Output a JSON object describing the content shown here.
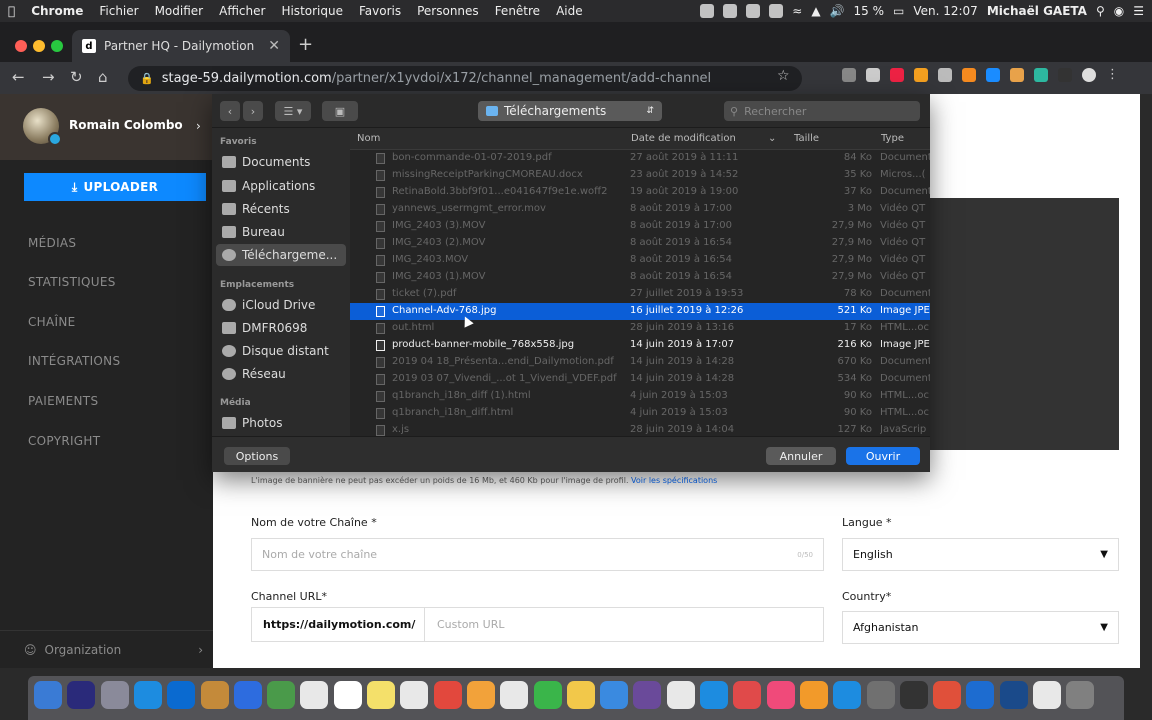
{
  "menubar": {
    "apple": "",
    "app": "Chrome",
    "items": [
      "Fichier",
      "Modifier",
      "Afficher",
      "Historique",
      "Favoris",
      "Personnes",
      "Fenêtre",
      "Aide"
    ],
    "battery": "15 %",
    "datetime": "Ven. 12:07",
    "user": "Michaël GAETA"
  },
  "browser": {
    "tab_title": "Partner HQ - Dailymotion",
    "tab_favicon": "d",
    "url_host": "stage-59.dailymotion.com",
    "url_path": "/partner/x1yvdoi/x172/channel_management/add-channel"
  },
  "sidebar": {
    "user_name": "Romain Colombo",
    "upload_label": "UPLOADER",
    "nav": [
      "MÉDIAS",
      "STATISTIQUES",
      "CHAÎNE",
      "INTÉGRATIONS",
      "PAIEMENTS",
      "COPYRIGHT"
    ],
    "org_label": "Organization"
  },
  "form": {
    "hint_text": "L'image de bannière ne peut pas excéder un poids de 16 Mb, et 460 Kb pour l'image de profil.",
    "hint_link": "Voir les spécifications",
    "name_label": "Nom de votre Chaîne *",
    "name_placeholder": "Nom de votre chaîne",
    "name_counter": "0/50",
    "lang_label": "Langue *",
    "lang_value": "English",
    "url_label": "Channel URL*",
    "url_prefix": "https://dailymotion.com/",
    "url_placeholder": "Custom URL",
    "country_label": "Country*",
    "country_value": "Afghanistan"
  },
  "dialog": {
    "location": "Téléchargements",
    "search_placeholder": "Rechercher",
    "sidebar_favoris_label": "Favoris",
    "favoris": [
      "Documents",
      "Applications",
      "Récents",
      "Bureau",
      "Téléchargeme..."
    ],
    "sidebar_emplacements_label": "Emplacements",
    "emplacements": [
      "iCloud Drive",
      "DMFR0698",
      "Disque distant",
      "Réseau"
    ],
    "sidebar_media_label": "Média",
    "media": [
      "Photos"
    ],
    "columns": {
      "name": "Nom",
      "date": "Date de modification",
      "size": "Taille",
      "type": "Type"
    },
    "files": [
      {
        "name": "bon-commande-01-07-2019.pdf",
        "date": "27 août 2019 à 11:11",
        "size": "84 Ko",
        "type": "Document",
        "state": "dim"
      },
      {
        "name": "missingReceiptParkingCMOREAU.docx",
        "date": "23 août 2019 à 14:52",
        "size": "35 Ko",
        "type": "Micros...(",
        "state": "dim"
      },
      {
        "name": "RetinaBold.3bbf9f01...e041647f9e1e.woff2",
        "date": "19 août 2019 à 19:00",
        "size": "37 Ko",
        "type": "Document",
        "state": "dim"
      },
      {
        "name": "yannews_usermgmt_error.mov",
        "date": "8 août 2019 à 17:00",
        "size": "3 Mo",
        "type": "Vidéo QT",
        "state": "dim"
      },
      {
        "name": "IMG_2403 (3).MOV",
        "date": "8 août 2019 à 17:00",
        "size": "27,9 Mo",
        "type": "Vidéo QT",
        "state": "dim"
      },
      {
        "name": "IMG_2403 (2).MOV",
        "date": "8 août 2019 à 16:54",
        "size": "27,9 Mo",
        "type": "Vidéo QT",
        "state": "dim"
      },
      {
        "name": "IMG_2403.MOV",
        "date": "8 août 2019 à 16:54",
        "size": "27,9 Mo",
        "type": "Vidéo QT",
        "state": "dim"
      },
      {
        "name": "IMG_2403 (1).MOV",
        "date": "8 août 2019 à 16:54",
        "size": "27,9 Mo",
        "type": "Vidéo QT",
        "state": "dim"
      },
      {
        "name": "ticket (7).pdf",
        "date": "27 juillet 2019 à 19:53",
        "size": "78 Ko",
        "type": "Document",
        "state": "dim"
      },
      {
        "name": "Channel-Adv-768.jpg",
        "date": "16 juillet 2019 à 12:26",
        "size": "521 Ko",
        "type": "Image JPE",
        "state": "selected"
      },
      {
        "name": "out.html",
        "date": "28 juin 2019 à 13:16",
        "size": "17 Ko",
        "type": "HTML...oc",
        "state": "dim"
      },
      {
        "name": "product-banner-mobile_768x558.jpg",
        "date": "14 juin 2019 à 17:07",
        "size": "216 Ko",
        "type": "Image JPE",
        "state": "enabled"
      },
      {
        "name": "2019 04 18_Présenta...endi_Dailymotion.pdf",
        "date": "14 juin 2019 à 14:28",
        "size": "670 Ko",
        "type": "Document",
        "state": "dim"
      },
      {
        "name": "2019 03 07_Vivendi_...ot 1_Vivendi_VDEF.pdf",
        "date": "14 juin 2019 à 14:28",
        "size": "534 Ko",
        "type": "Document",
        "state": "dim"
      },
      {
        "name": "q1branch_i18n_diff (1).html",
        "date": "4 juin 2019 à 15:03",
        "size": "90 Ko",
        "type": "HTML...oc",
        "state": "dim"
      },
      {
        "name": "q1branch_i18n_diff.html",
        "date": "4 juin 2019 à 15:03",
        "size": "90 Ko",
        "type": "HTML...oc",
        "state": "dim"
      },
      {
        "name": "x.js",
        "date": "28 juin 2019 à 14:04",
        "size": "127 Ko",
        "type": "JavaScrip",
        "state": "dim"
      }
    ],
    "options_label": "Options",
    "cancel_label": "Annuler",
    "open_label": "Ouvrir"
  },
  "colors": {
    "accent": "#0d89ff",
    "selection": "#0b5ed7",
    "sidebar_bg": "#232323"
  }
}
